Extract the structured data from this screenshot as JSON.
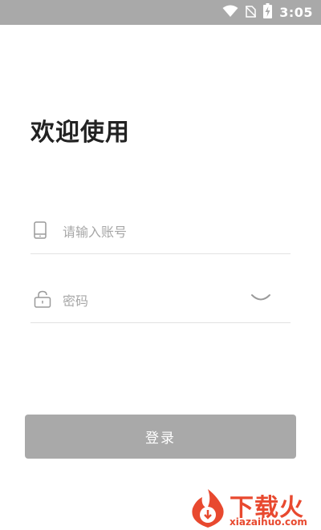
{
  "status_bar": {
    "time": "3:05",
    "icons": [
      "wifi-icon",
      "no-sim-icon",
      "battery-charging-icon"
    ]
  },
  "welcome_title": "欢迎使用",
  "account": {
    "placeholder": "请输入账号",
    "value": "",
    "icon": "phone-icon"
  },
  "password": {
    "placeholder": "密码",
    "value": "",
    "icon": "lock-icon",
    "toggle_icon": "eye-closed-icon"
  },
  "login_button_label": "登录",
  "watermark": {
    "text": "下载火",
    "url": "xiazaihuo.com"
  },
  "colors": {
    "status_bar": "#a9a9a9",
    "button": "#a9a9a9",
    "divider": "#e2e2e2",
    "placeholder": "#a7a7a7",
    "watermark": "#e8492f"
  }
}
